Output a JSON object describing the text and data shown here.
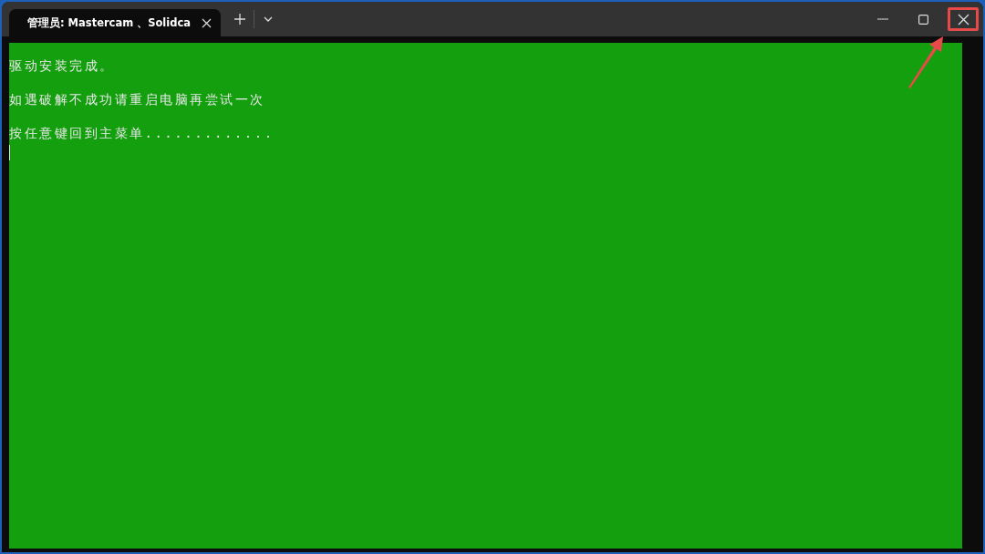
{
  "tabs": [
    {
      "title": "管理员: Mastercam 、Solidca",
      "selected": true
    }
  ],
  "window_controls": {
    "close_highlighted": true
  },
  "console": {
    "lines": [
      "驱动安装完成。",
      "如遇破解不成功请重启电脑再尝试一次",
      "按任意键回到主菜单............."
    ],
    "cursor": true
  }
}
